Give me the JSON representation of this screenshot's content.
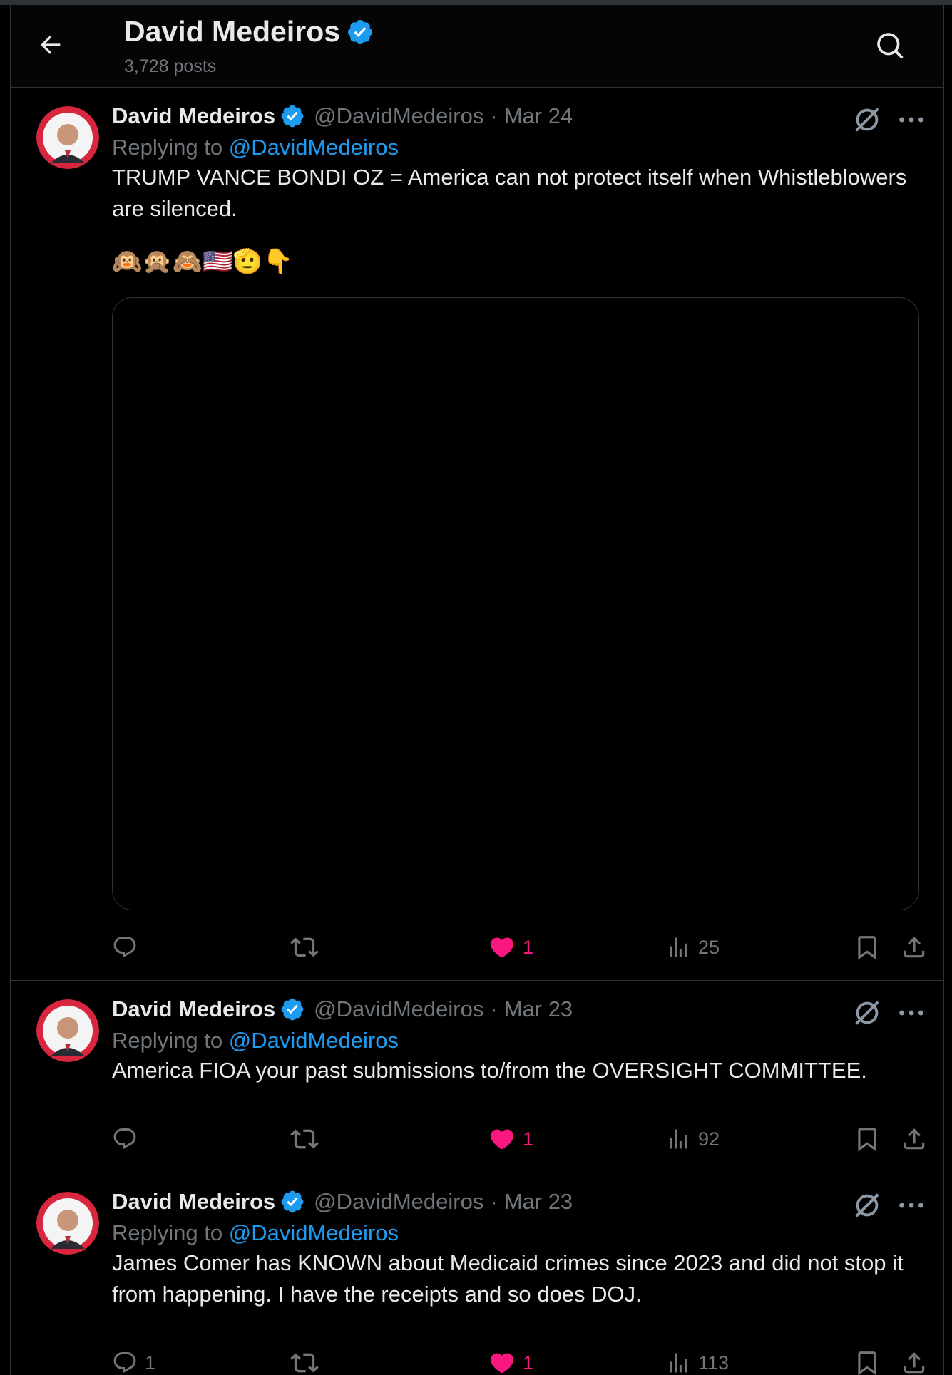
{
  "header": {
    "title": "David Medeiros",
    "posts_count": "3,728 posts"
  },
  "colors": {
    "background": "#000000",
    "text_primary": "#e7e9ea",
    "text_secondary": "#71767b",
    "link": "#1d9bf0",
    "verified": "#1d9bf0",
    "like": "#f91880",
    "border": "#2f3336"
  },
  "icons": {
    "back": "arrow-left-icon",
    "search": "search-icon",
    "verified": "verified-badge-icon",
    "grok": "grok-icon",
    "more": "more-icon",
    "reply": "reply-icon",
    "repost": "repost-icon",
    "like": "heart-icon",
    "views": "views-icon",
    "bookmark": "bookmark-icon",
    "share": "share-icon"
  },
  "posts": [
    {
      "name": "David Medeiros",
      "handle": "@DavidMedeiros",
      "dot": "·",
      "date": "Mar 24",
      "replying_prefix": "Replying to ",
      "replying_to": "@DavidMedeiros",
      "text": "TRUMP VANCE BONDI OZ = America can not protect itself when Whistleblowers are silenced.",
      "emojis": "🙉🙊🙈🇺🇸🫡👇",
      "reply_count": "",
      "repost_count": "",
      "like_count": "1",
      "view_count": "25"
    },
    {
      "name": "David Medeiros",
      "handle": "@DavidMedeiros",
      "dot": "·",
      "date": "Mar 23",
      "replying_prefix": "Replying to ",
      "replying_to": "@DavidMedeiros",
      "text": "America FIOA your past submissions to/from the OVERSIGHT COMMITTEE.",
      "reply_count": "",
      "repost_count": "",
      "like_count": "1",
      "view_count": "92"
    },
    {
      "name": "David Medeiros",
      "handle": "@DavidMedeiros",
      "dot": "·",
      "date": "Mar 23",
      "replying_prefix": "Replying to ",
      "replying_to": "@DavidMedeiros",
      "text": "James Comer has KNOWN about Medicaid crimes since 2023 and did not stop it from happening. I have the receipts and so does DOJ.",
      "reply_count": "1",
      "repost_count": "",
      "like_count": "1",
      "view_count": "113"
    }
  ]
}
